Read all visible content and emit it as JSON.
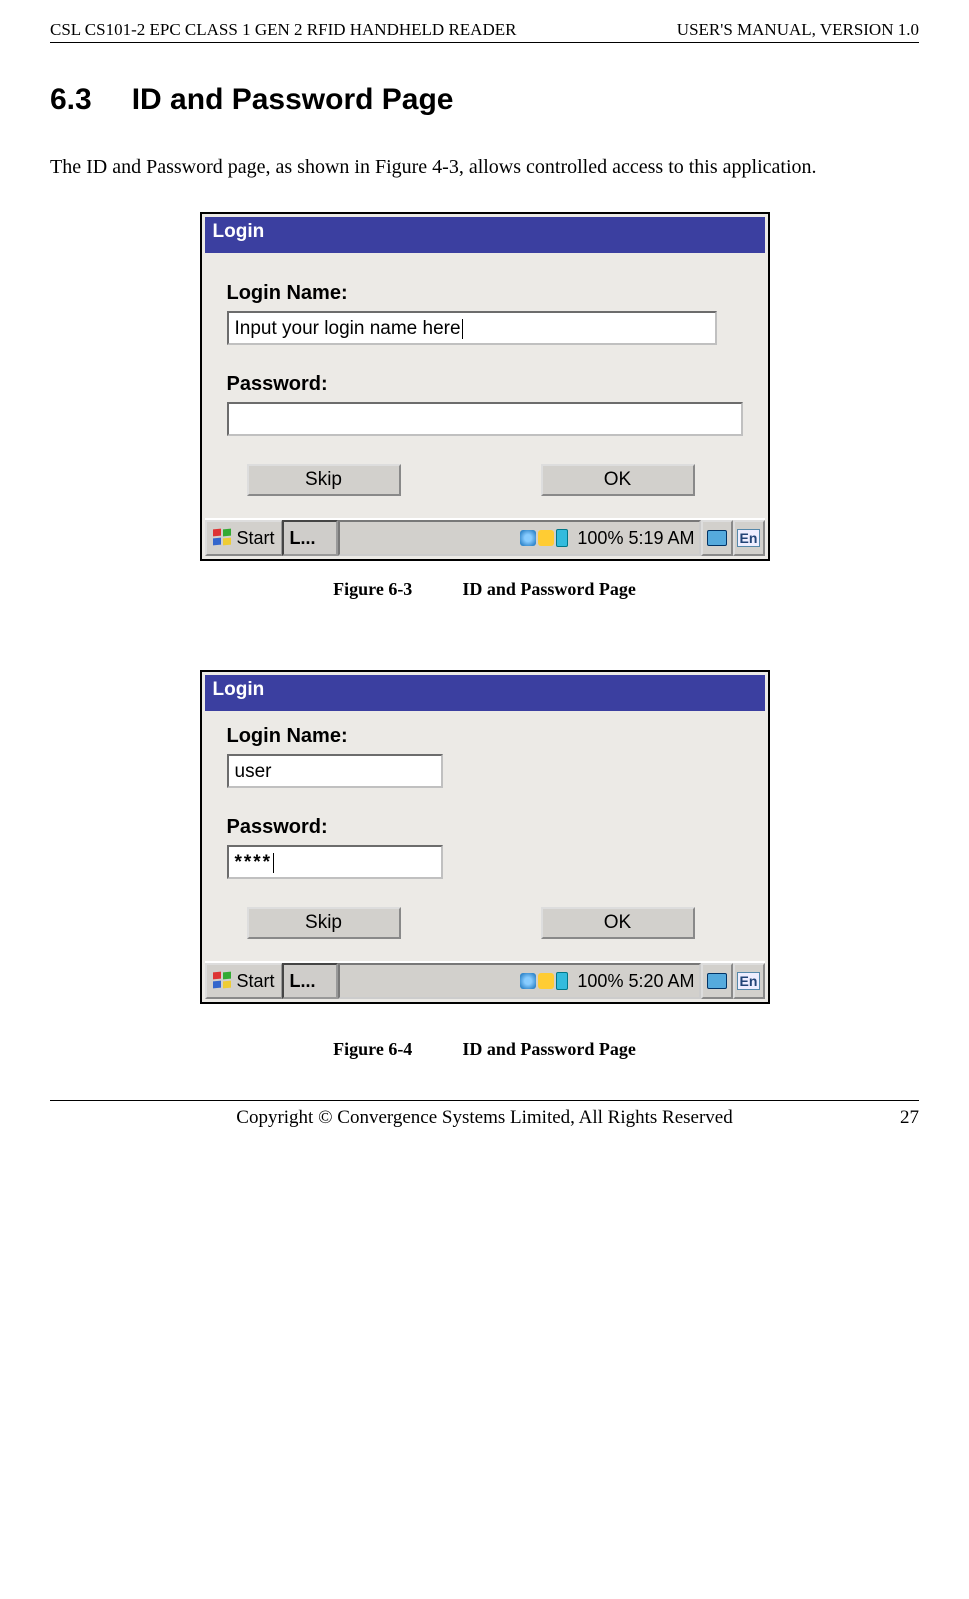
{
  "header": {
    "left": "CSL CS101-2 EPC CLASS 1 GEN 2 RFID HANDHELD READER",
    "right": "USER'S  MANUAL,  VERSION  1.0"
  },
  "section": {
    "number": "6.3",
    "title": "ID and Password Page"
  },
  "paragraph": "The ID and Password page, as shown in Figure 4-3, allows controlled access to this application.",
  "figure1": {
    "titlebar": "Login",
    "login_label": "Login Name:",
    "login_value": "Input your login name here",
    "password_label": "Password:",
    "password_value": "",
    "skip": "Skip",
    "ok": "OK",
    "taskbar": {
      "start": "Start",
      "app": "L...",
      "status": "100% 5:19 AM",
      "lang": "En"
    },
    "caption_num": "Figure 6-3",
    "caption_text": "ID and Password Page"
  },
  "figure2": {
    "titlebar": "Login",
    "login_label": "Login Name:",
    "login_value": "user",
    "password_label": "Password:",
    "password_value": "****",
    "skip": "Skip",
    "ok": "OK",
    "taskbar": {
      "start": "Start",
      "app": "L...",
      "status": "100% 5:20 AM",
      "lang": "En"
    },
    "caption_num": "Figure 6-4",
    "caption_text": "ID and Password Page"
  },
  "footer": {
    "text": "Copyright © Convergence Systems Limited, All Rights Reserved",
    "page": "27"
  }
}
